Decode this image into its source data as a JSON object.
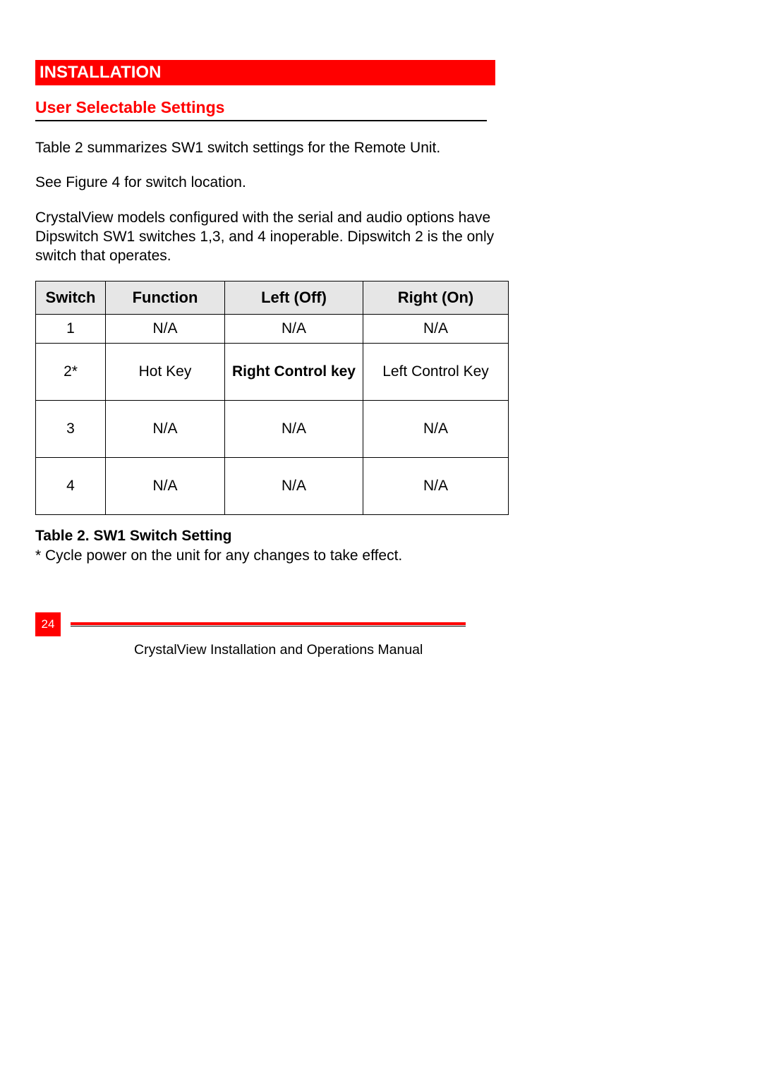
{
  "banner": "INSTALLATION",
  "subheading": "User Selectable Settings",
  "paras": {
    "p1a": "Table 2 ",
    "p1b": "summarizes SW1 switch settings for the Remote Unit.",
    "p2a": "See ",
    "p2b": "Figure 4 ",
    "p2c": "for switch location.",
    "p3": "CrystalView models configured with the serial and audio options have Dipswitch SW1 switches 1,3, and 4 inoperable.  Dipswitch 2 is the only switch that operates."
  },
  "table": {
    "headers": {
      "c1": "Switch",
      "c2": "Function",
      "c3": "Left (Off)",
      "c4": "Right (On)"
    },
    "rows": [
      {
        "c1": "1",
        "c2": "N/A",
        "c3": "N/A",
        "c4": "N/A",
        "tall": false,
        "boldC3": false
      },
      {
        "c1": "2*",
        "c2": "Hot Key",
        "c3": "Right Control key",
        "c4": "Left Control Key",
        "tall": true,
        "boldC3": true
      },
      {
        "c1": "3",
        "c2": "N/A",
        "c3": "N/A",
        "c4": "N/A",
        "tall": true,
        "boldC3": false
      },
      {
        "c1": "4",
        "c2": "N/A",
        "c3": "N/A",
        "c4": "N/A",
        "tall": true,
        "boldC3": false
      }
    ]
  },
  "caption": "Table 2. SW1 Switch Setting",
  "footnote": "* Cycle power on the unit for any changes to take effect.",
  "footer": {
    "page": "24",
    "title": "CrystalView Installation and Operations Manual"
  }
}
